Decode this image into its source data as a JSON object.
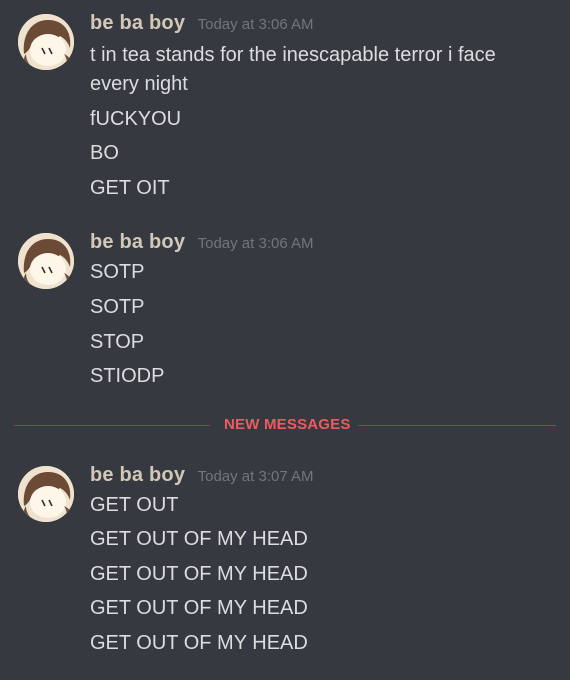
{
  "theme": {
    "background": "#36393f",
    "username_color": "#d3c8b8",
    "timestamp_color": "#72767d",
    "message_color": "#dcddde",
    "new_messages_color": "#ee5a5f"
  },
  "groups": [
    {
      "username": "be ba boy",
      "timestamp": "Today at 3:06 AM",
      "avatar_icon": "chibi-character-avatar",
      "messages": [
        "t in tea stands for the inescapable terror i face",
        "every night",
        "fUCKYOU",
        "BO",
        "GET OIT"
      ]
    },
    {
      "username": "be ba boy",
      "timestamp": "Today at 3:06 AM",
      "avatar_icon": "chibi-character-avatar",
      "messages": [
        "SOTP",
        "SOTP",
        "STOP",
        "STIODP"
      ]
    },
    {
      "username": "be ba boy",
      "timestamp": "Today at 3:07 AM",
      "avatar_icon": "chibi-character-avatar",
      "messages": [
        "GET OUT",
        "GET OUT OF MY HEAD",
        "GET OUT OF MY HEAD",
        "GET OUT OF MY HEAD",
        "GET OUT OF MY HEAD"
      ]
    }
  ],
  "divider": {
    "label": "NEW MESSAGES"
  }
}
